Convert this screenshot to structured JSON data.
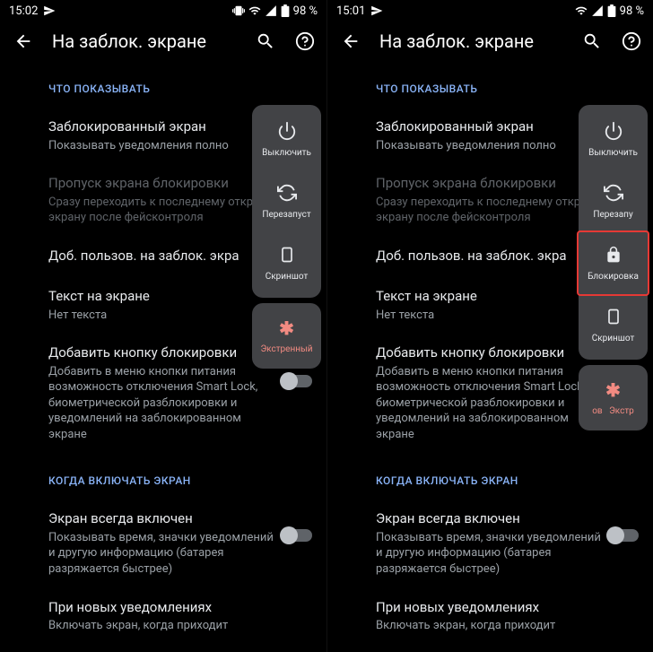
{
  "left": {
    "time": "15:02",
    "battery": "98 %",
    "title": "На заблок. экране",
    "sections": {
      "what": "ЧТО ПОКАЗЫВАТЬ",
      "when": "КОГДА ВКЛЮЧАТЬ ЭКРАН"
    },
    "items": {
      "locked": {
        "title": "Заблокированный экран",
        "sub": "Показывать уведомления полно"
      },
      "skip": {
        "title": "Пропуск экрана блокировки",
        "sub": "Сразу переходить к последнему открытому экрану после фейсконтроля"
      },
      "addusers": {
        "title": "Доб. пользов. на заблок. экра"
      },
      "text": {
        "title": "Текст на экране",
        "sub": "Нет текста"
      },
      "lockbtn": {
        "title": "Добавить кнопку блокировки",
        "sub": "Добавить в меню кнопки питания возможность отключения Smart Lock, биометрической разблокировки и уведомлений на заблокированном экране"
      },
      "aod": {
        "title": "Экран всегда включен",
        "sub": "Показывать время, значки уведомлений и другую информацию (батарея разряжается быстрее)"
      },
      "newnotif": {
        "title": "При новых уведомлениях",
        "sub": "Включать экран, когда приходит"
      }
    },
    "power": {
      "off": "Выключить",
      "restart": "Перезапуст",
      "screenshot": "Скриншот",
      "emergency": "Экстренный"
    }
  },
  "right": {
    "time": "15:01",
    "battery": "98 %",
    "title": "На заблок. экране",
    "sections": {
      "what": "ЧТО ПОКАЗЫВАТЬ",
      "when": "КОГДА ВКЛЮЧАТЬ ЭКРАН"
    },
    "items": {
      "locked": {
        "title": "Заблокированный экран",
        "sub": "Показывать уведомления полно"
      },
      "skip": {
        "title": "Пропуск экрана блокировки",
        "sub": "Сразу переходить к последнему открытому экрану после фейсконтроля"
      },
      "addusers": {
        "title": "Доб. пользов. на заблок. экра"
      },
      "text": {
        "title": "Текст на экране",
        "sub": "Нет текста"
      },
      "lockbtn": {
        "title": "Добавить кнопку блокировки",
        "sub": "Добавить в меню кнопки питания возможность отключения Smart Lock, биометрической разблокировки и уведомлений на заблокированном экране"
      },
      "aod": {
        "title": "Экран всегда включен",
        "sub": "Показывать время, значки уведомлений и другую информацию (батарея разряжается быстрее)"
      },
      "newnotif": {
        "title": "При новых уведомлениях",
        "sub": "Включать экран, когда приходит"
      }
    },
    "power": {
      "off": "Выключить",
      "restart": "Перезапу",
      "lock": "Блокировка",
      "screenshot": "Скриншот",
      "emergency_p1": "ов",
      "emergency_p3": "Экстр"
    }
  }
}
